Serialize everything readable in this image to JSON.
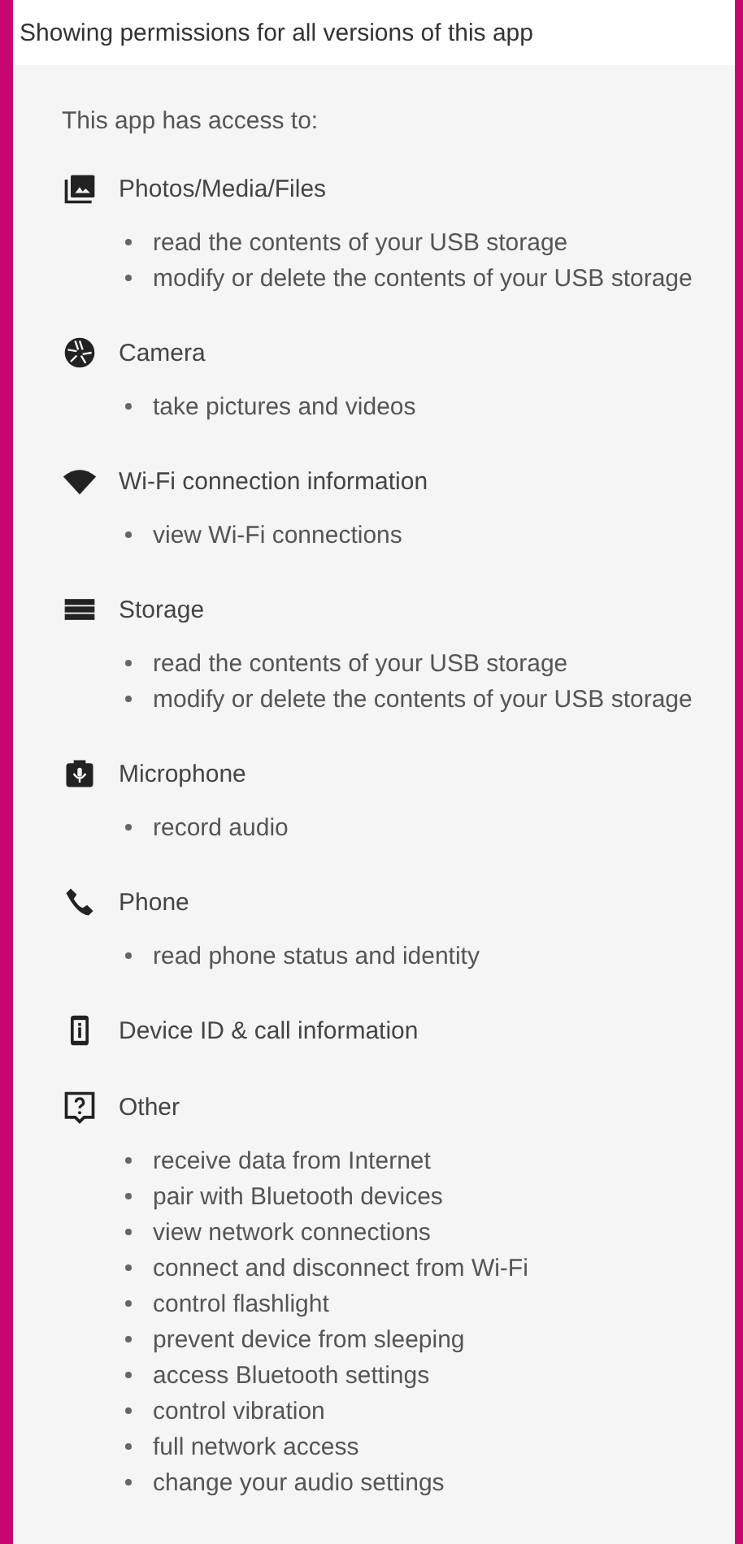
{
  "header": "Showing permissions for all versions of this app",
  "intro": "This app has access to:",
  "groups": [
    {
      "title": "Photos/Media/Files",
      "items": [
        "read the contents of your USB storage",
        "modify or delete the contents of your USB storage"
      ]
    },
    {
      "title": "Camera",
      "items": [
        "take pictures and videos"
      ]
    },
    {
      "title": "Wi-Fi connection information",
      "items": [
        "view Wi-Fi connections"
      ]
    },
    {
      "title": "Storage",
      "items": [
        "read the contents of your USB storage",
        "modify or delete the contents of your USB storage"
      ]
    },
    {
      "title": "Microphone",
      "items": [
        "record audio"
      ]
    },
    {
      "title": "Phone",
      "items": [
        "read phone status and identity"
      ]
    },
    {
      "title": "Device ID & call information"
    },
    {
      "title": "Other",
      "items": [
        "receive data from Internet",
        "pair with Bluetooth devices",
        "view network connections",
        "connect and disconnect from Wi-Fi",
        "control flashlight",
        "prevent device from sleeping",
        "access Bluetooth settings",
        "control vibration",
        "full network access",
        "change your audio settings"
      ]
    }
  ]
}
